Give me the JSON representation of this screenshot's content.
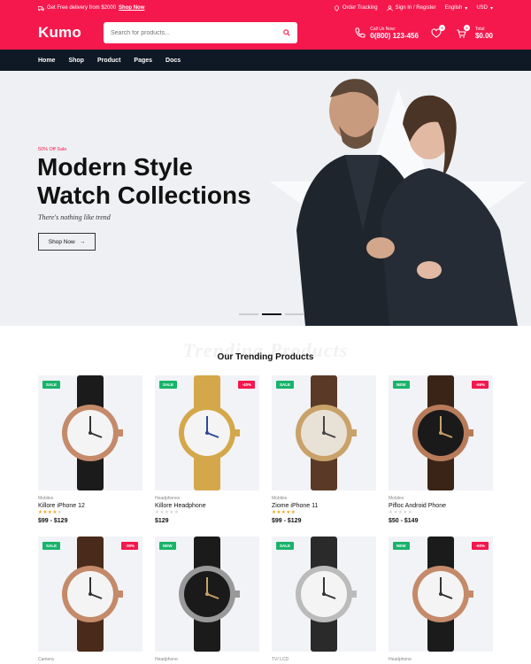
{
  "topbar": {
    "promo_text": "Get Free delivery from $2000",
    "promo_link": "Shop Now",
    "order_tracking": "Order Tracking",
    "sign_in": "Sign In / Register",
    "language": "English",
    "currency": "USD"
  },
  "header": {
    "logo": "Kumo",
    "search_placeholder": "Search for products...",
    "call_label": "Call Us Now:",
    "call_number": "0(800) 123-456",
    "wishlist_count": "0",
    "cart_count": "0",
    "total_label": "Total",
    "total_amount": "$0.00"
  },
  "nav": [
    "Home",
    "Shop",
    "Product",
    "Pages",
    "Docs"
  ],
  "hero": {
    "offer": "50% Off Sale",
    "title_line1": "Modern Style",
    "title_line2": "Watch Collections",
    "subtitle": "There's nothing like trend",
    "button": "Shop Now"
  },
  "trending": {
    "background_text": "Trending Products",
    "title": "Our Trending Products"
  },
  "products": [
    {
      "category": "Mobiles",
      "name": "Killore iPhone 12",
      "price": "$99 - $129",
      "rating": 4,
      "tag_left": "SALE",
      "tag_right": ""
    },
    {
      "category": "Headphones",
      "name": "Killore Headphone",
      "price": "$129",
      "rating": 0,
      "tag_left": "SALE",
      "tag_right": "-40%"
    },
    {
      "category": "Mobiles",
      "name": "Ziome iPhone 11",
      "price": "$99 - $129",
      "rating": 5,
      "tag_left": "SALE",
      "tag_right": ""
    },
    {
      "category": "Mobiles",
      "name": "Pifloc Android Phone",
      "price": "$50 - $149",
      "rating": 0,
      "tag_left": "NEW",
      "tag_right": "-55%"
    },
    {
      "category": "Camera",
      "name": "",
      "price": "",
      "rating": 0,
      "tag_left": "SALE",
      "tag_right": "-30%"
    },
    {
      "category": "Headphone",
      "name": "",
      "price": "",
      "rating": 0,
      "tag_left": "NEW",
      "tag_right": ""
    },
    {
      "category": "TV/ LCD",
      "name": "",
      "price": "",
      "rating": 0,
      "tag_left": "SALE",
      "tag_right": ""
    },
    {
      "category": "Headphone",
      "name": "",
      "price": "",
      "rating": 0,
      "tag_left": "NEW",
      "tag_right": "-60%"
    }
  ],
  "colors": {
    "brand": "#f5184d",
    "nav_bg": "#0f1825",
    "sale_tag": "#19b46b",
    "star": "#f1a317"
  }
}
